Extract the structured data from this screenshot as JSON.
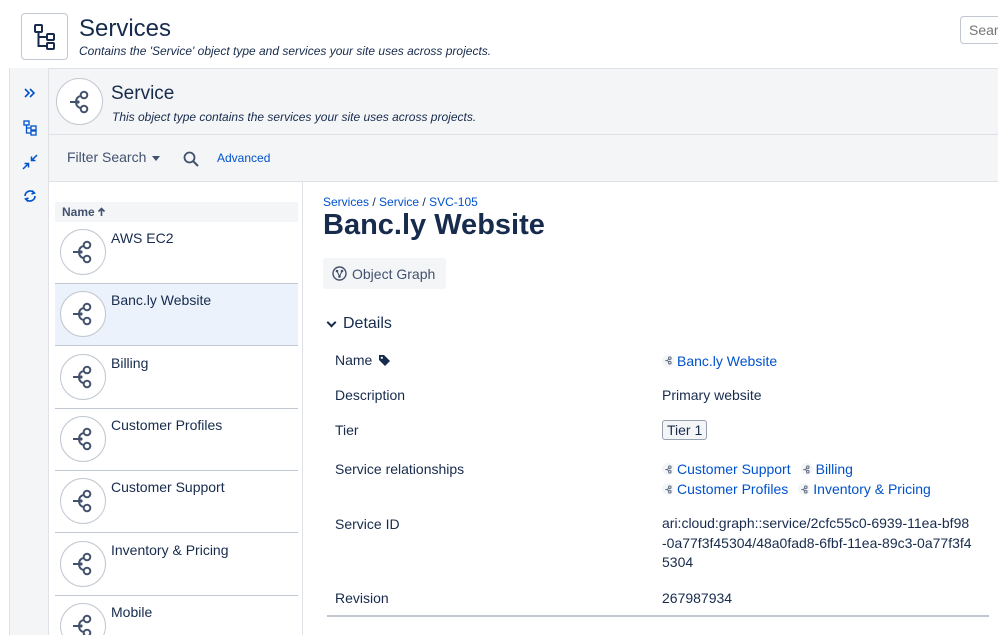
{
  "header": {
    "title": "Services",
    "subtitle": "Contains the 'Service' object type and services your site uses across projects.",
    "search_placeholder": "Search"
  },
  "rail": {
    "icons": [
      "expand-icon",
      "hierarchy-icon",
      "collapse-icon",
      "refresh-icon"
    ]
  },
  "object_type": {
    "title": "Service",
    "subtitle": "This object type contains the services your site uses across projects.",
    "filter_label": "Filter Search",
    "advanced_label": "Advanced"
  },
  "list": {
    "column_header": "Name",
    "sort_icon": "arrow-up-icon",
    "items": [
      {
        "label": "AWS EC2"
      },
      {
        "label": "Banc.ly Website",
        "selected": true
      },
      {
        "label": "Billing"
      },
      {
        "label": "Customer Profiles"
      },
      {
        "label": "Customer Support"
      },
      {
        "label": "Inventory & Pricing"
      },
      {
        "label": "Mobile"
      }
    ]
  },
  "detail": {
    "breadcrumb": {
      "crumbs": [
        "Services",
        "Service",
        "SVC-105"
      ],
      "separator": "/"
    },
    "title": "Banc.ly Website",
    "object_graph_label": "Object Graph",
    "section_label": "Details",
    "attributes": {
      "name_label": "Name",
      "name_value": "Banc.ly Website",
      "description_label": "Description",
      "description_value": "Primary website",
      "tier_label": "Tier",
      "tier_value": "Tier 1",
      "relationships_label": "Service relationships",
      "relationships": [
        "Customer Support",
        "Billing",
        "Customer Profiles",
        "Inventory & Pricing"
      ],
      "service_id_label": "Service ID",
      "service_id_value": "ari:cloud:graph::service/2cfc55c0-6939-11ea-bf98-0a77f3f45304/48a0fad8-6fbf-11ea-89c3-0a77f3f45304",
      "revision_label": "Revision",
      "revision_value": "267987934"
    }
  },
  "colors": {
    "link": "#0052cc",
    "text": "#172b4d",
    "panel_bg": "#f4f5f7",
    "selected_bg": "#ebf2fb",
    "border": "#c1c7d0"
  }
}
